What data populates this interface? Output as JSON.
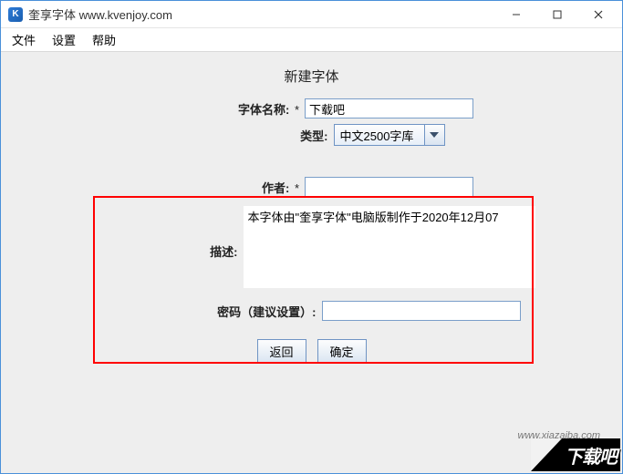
{
  "window": {
    "title": "奎享字体 www.kvenjoy.com",
    "app_icon_letter": "K"
  },
  "menubar": {
    "file": "文件",
    "settings": "设置",
    "help": "帮助"
  },
  "form": {
    "heading": "新建字体",
    "font_name_label": "字体名称:",
    "font_name_required": "*",
    "font_name_value": "下载吧",
    "type_label": "类型:",
    "type_value": "中文2500字库",
    "author_label": "作者:",
    "author_required": "*",
    "author_value": "",
    "description_label": "描述:",
    "description_value": "本字体由\"奎享字体\"电脑版制作于2020年12月07",
    "password_label": "密码（建议设置）:",
    "password_value": "",
    "back_button": "返回",
    "ok_button": "确定"
  },
  "watermark": {
    "url": "www.xiazaiba.com",
    "logo_text": "下载吧"
  }
}
